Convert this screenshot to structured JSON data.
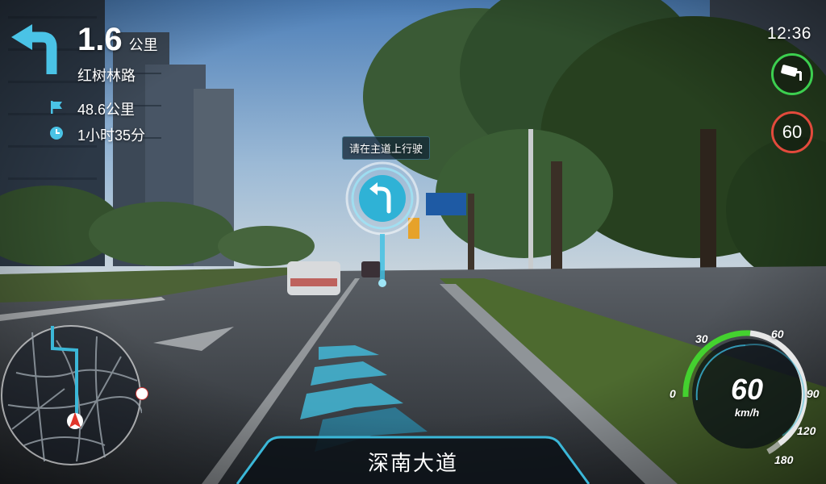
{
  "status": {
    "time": "12:36",
    "speed_limit": "60"
  },
  "navigation": {
    "distance_value": "1.6",
    "distance_unit": "公里",
    "street_name": "红树林路",
    "remaining_distance": "48.6公里",
    "remaining_time": "1小时35分"
  },
  "ar_overlay": {
    "lane_hint": "请在主道上行驶"
  },
  "road": {
    "current_name": "深南大道"
  },
  "speedometer": {
    "speed": "60",
    "unit": "km/h",
    "ticks": [
      "0",
      "30",
      "60",
      "90",
      "120",
      "180"
    ],
    "current_fraction": 0.33
  },
  "colors": {
    "accent": "#3bb7d8",
    "speed_arc": "#44d12f",
    "limit_ring": "#e24a3c",
    "camera_ring": "#3ccf4f"
  }
}
